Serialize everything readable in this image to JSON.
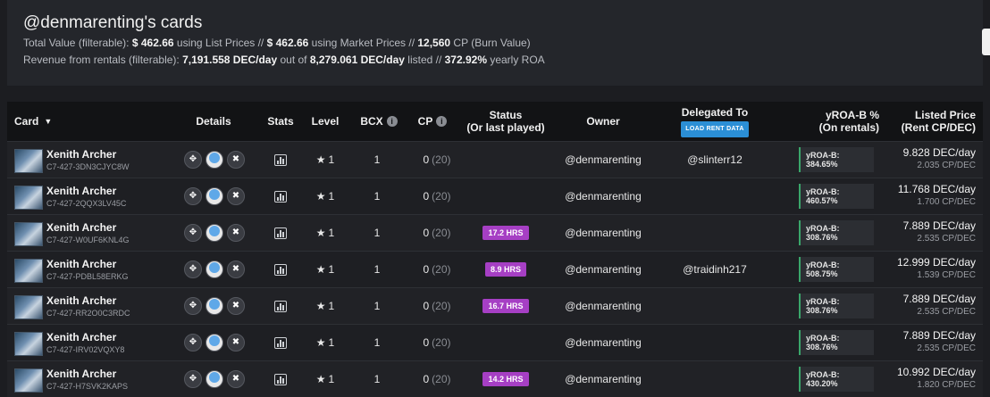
{
  "header": {
    "title": "@denmarenting's cards",
    "line1": {
      "pre": "Total Value (filterable): ",
      "list_value": "$ 462.66",
      "list_text": " using List Prices // ",
      "market_value": "$ 462.66",
      "market_text": " using Market Prices // ",
      "cp_value": "12,560",
      "cp_text": " CP (Burn Value)"
    },
    "line2": {
      "pre": "Revenue from rentals (filterable): ",
      "rent_value": "7,191.558 DEC/day",
      "mid": " out of ",
      "listed_value": "8,279.061 DEC/day",
      "listed_text": " listed // ",
      "roa_value": "372.92%",
      "roa_text": " yearly ROA"
    }
  },
  "columns": {
    "card": "Card",
    "details": "Details",
    "stats": "Stats",
    "level": "Level",
    "bcx": "BCX",
    "cp": "CP",
    "status_1": "Status",
    "status_2": "(Or last played)",
    "owner": "Owner",
    "delegated": "Delegated To",
    "load_rent": "LOAD RENT DATA",
    "yroa_1": "yROA-B %",
    "yroa_2": "(On rentals)",
    "price_1": "Listed Price",
    "price_2": "(Rent CP/DEC)"
  },
  "rows": [
    {
      "name": "Xenith Archer",
      "id": "C7-427-3DN3CJYC8W",
      "level": "1",
      "bcx": "1",
      "cp": "0",
      "cp_paren": "(20)",
      "status": "",
      "owner": "@denmarenting",
      "delegated": "@slinterr12",
      "yroa": "yROA-B: 384.65%",
      "price": "9.828 DEC/day",
      "cpdec": "2.035 CP/DEC"
    },
    {
      "name": "Xenith Archer",
      "id": "C7-427-2QQX3LV45C",
      "level": "1",
      "bcx": "1",
      "cp": "0",
      "cp_paren": "(20)",
      "status": "",
      "owner": "@denmarenting",
      "delegated": "",
      "yroa": "yROA-B: 460.57%",
      "price": "11.768 DEC/day",
      "cpdec": "1.700 CP/DEC"
    },
    {
      "name": "Xenith Archer",
      "id": "C7-427-W0UF6KNL4G",
      "level": "1",
      "bcx": "1",
      "cp": "0",
      "cp_paren": "(20)",
      "status": "17.2 HRS",
      "owner": "@denmarenting",
      "delegated": "",
      "yroa": "yROA-B: 308.76%",
      "price": "7.889 DEC/day",
      "cpdec": "2.535 CP/DEC"
    },
    {
      "name": "Xenith Archer",
      "id": "C7-427-PDBL58ERKG",
      "level": "1",
      "bcx": "1",
      "cp": "0",
      "cp_paren": "(20)",
      "status": "8.9 HRS",
      "owner": "@denmarenting",
      "delegated": "@traidinh217",
      "yroa": "yROA-B: 508.75%",
      "price": "12.999 DEC/day",
      "cpdec": "1.539 CP/DEC"
    },
    {
      "name": "Xenith Archer",
      "id": "C7-427-RR2O0C3RDC",
      "level": "1",
      "bcx": "1",
      "cp": "0",
      "cp_paren": "(20)",
      "status": "16.7 HRS",
      "owner": "@denmarenting",
      "delegated": "",
      "yroa": "yROA-B: 308.76%",
      "price": "7.889 DEC/day",
      "cpdec": "2.535 CP/DEC"
    },
    {
      "name": "Xenith Archer",
      "id": "C7-427-IRV02VQXY8",
      "level": "1",
      "bcx": "1",
      "cp": "0",
      "cp_paren": "(20)",
      "status": "",
      "owner": "@denmarenting",
      "delegated": "",
      "yroa": "yROA-B: 308.76%",
      "price": "7.889 DEC/day",
      "cpdec": "2.535 CP/DEC"
    },
    {
      "name": "Xenith Archer",
      "id": "C7-427-H7SVK2KAPS",
      "level": "1",
      "bcx": "1",
      "cp": "0",
      "cp_paren": "(20)",
      "status": "14.2 HRS",
      "owner": "@denmarenting",
      "delegated": "",
      "yroa": "yROA-B: 430.20%",
      "price": "10.992 DEC/day",
      "cpdec": "1.820 CP/DEC"
    }
  ],
  "colors": {
    "status_badge": "#a63fc4",
    "yroa_accent": "#3aa66a",
    "load_button": "#2b8fd6"
  }
}
